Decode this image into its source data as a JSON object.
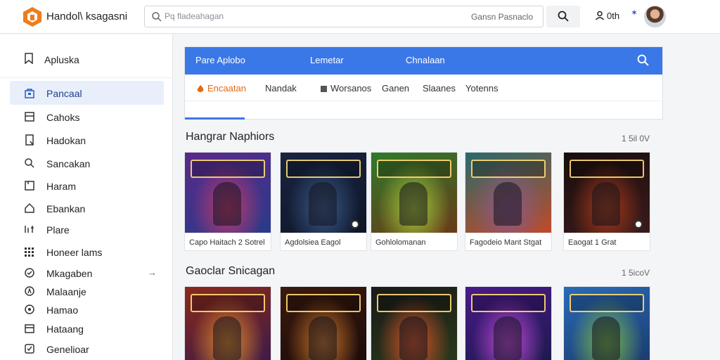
{
  "header": {
    "app_title": "Handol\\ ksagasni",
    "search_placeholder": "Pq fladeahagan",
    "search_hint": "Gansn Pasnaclo",
    "account_label": "0th"
  },
  "sidebar": {
    "header_label": "Apluska",
    "items": [
      {
        "label": "Pancaal",
        "icon": "bag-icon",
        "active": true
      },
      {
        "label": "Cahoks",
        "icon": "box-icon"
      },
      {
        "label": "Hadokan",
        "icon": "document-icon"
      },
      {
        "label": "Sancakan",
        "icon": "search-icon"
      },
      {
        "label": "Haram",
        "icon": "square-icon"
      },
      {
        "label": "Ebankan",
        "icon": "home-icon"
      },
      {
        "label": "Plare",
        "icon": "text-icon"
      },
      {
        "label": "Honeer lams",
        "icon": "grid-icon"
      },
      {
        "label": "Mkagaben",
        "icon": "circle-check-icon",
        "arrow": "→"
      },
      {
        "label": "Malaanje",
        "icon": "compass-icon"
      },
      {
        "label": "Hamao",
        "icon": "target-icon"
      },
      {
        "label": "Hataang",
        "icon": "calendar-icon"
      },
      {
        "label": "Genelioar",
        "icon": "checkbox-icon"
      }
    ]
  },
  "panel": {
    "tabs": [
      "Pare Aplobo",
      "Lemetar",
      "Chnalaan"
    ],
    "filters": [
      "Encaatan",
      "Nandak",
      "Worsanos",
      "Ganen",
      "Slaanes",
      "Yotenns"
    ]
  },
  "sections": [
    {
      "title": "Hangrar Naphiors",
      "meta": "1 5il 0V",
      "cards": [
        {
          "caption": "Capo Haitach 2 Sotrel",
          "colors": [
            "#5a2a8a",
            "#c03a6a",
            "#2a3a8a"
          ]
        },
        {
          "caption": "Agdolsiea  Eagol",
          "colors": [
            "#1a2440",
            "#3a5a8a",
            "#0e1628"
          ]
        },
        {
          "caption": "Gohlolomanan",
          "colors": [
            "#2f7a2a",
            "#a8c83a",
            "#6a3a1a"
          ]
        },
        {
          "caption": "Fagodeio Mant    Stgat",
          "colors": [
            "#2a6a6a",
            "#8a5a8a",
            "#c04a2a"
          ]
        },
        {
          "caption": "Eaogat        1   Grat",
          "colors": [
            "#1a0e0e",
            "#a83a1a",
            "#3a1a1a"
          ]
        }
      ]
    },
    {
      "title": "Gaoclar Snicagan",
      "meta": "1 5icoV",
      "cards": [
        {
          "caption": "",
          "colors": [
            "#8a2a1a",
            "#e08a2a",
            "#3a1a4a"
          ]
        },
        {
          "caption": "",
          "colors": [
            "#3a1a0e",
            "#c8742a",
            "#1a0a0a"
          ]
        },
        {
          "caption": "",
          "colors": [
            "#1a1a1a",
            "#d8542a",
            "#2a3a1a"
          ]
        },
        {
          "caption": "",
          "colors": [
            "#4a1a8a",
            "#c04ad8",
            "#1a1a4a"
          ]
        },
        {
          "caption": "",
          "colors": [
            "#2a6ab8",
            "#7ab84a",
            "#1a3a6a"
          ]
        }
      ]
    }
  ]
}
